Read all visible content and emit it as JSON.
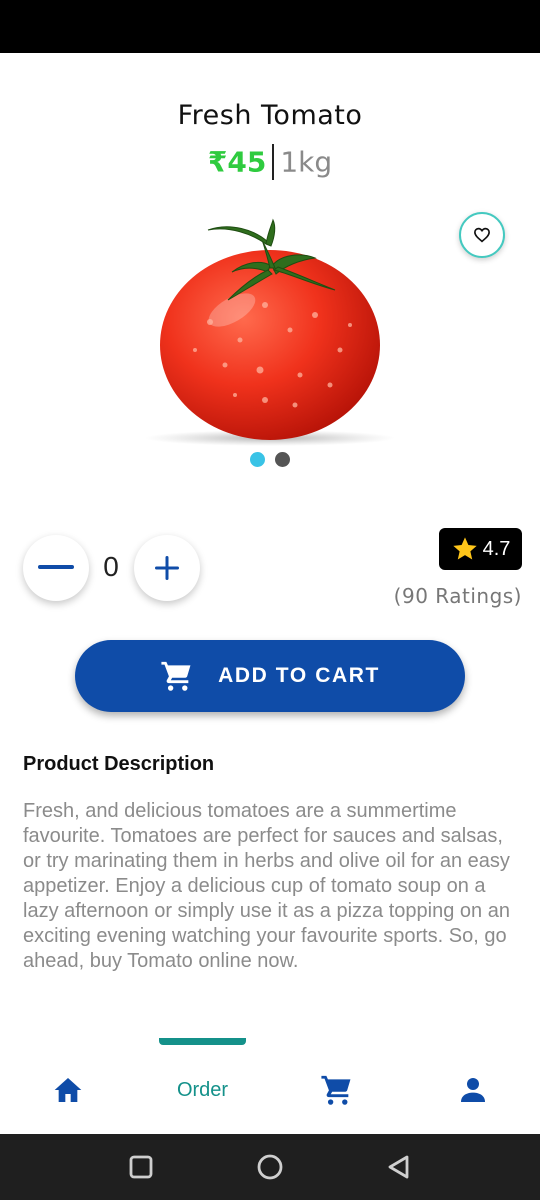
{
  "product": {
    "name": "Fresh Tomato",
    "price": "₹45",
    "unit": "1kg",
    "image_icon": "tomato-image"
  },
  "carousel": {
    "count": 2,
    "active_index": 0,
    "active_color": "#39c3e6",
    "inactive_color": "#555555"
  },
  "quantity": {
    "value": "0",
    "minus_icon": "minus-icon",
    "plus_icon": "plus-icon"
  },
  "rating": {
    "value": "4.7",
    "count_label": "(90 Ratings)",
    "icon": "star-icon"
  },
  "cart_button": {
    "label": "ADD TO CART",
    "icon": "cart-icon",
    "color": "#0f4ca8"
  },
  "description": {
    "title": "Product Description",
    "text": "Fresh, and delicious tomatoes are a summertime favourite. Tomatoes are perfect for sauces and salsas, or try marinating them in herbs and olive oil for an easy appetizer. Enjoy a delicious cup of tomato soup on a lazy afternoon or simply use it as a pizza topping on an exciting evening watching your favourite sports. So, go ahead, buy Tomato online now."
  },
  "bottom_nav": {
    "items": [
      {
        "name": "home",
        "icon": "home-icon"
      },
      {
        "name": "order",
        "label": "Order",
        "active": true
      },
      {
        "name": "cart",
        "icon": "cart-icon"
      },
      {
        "name": "profile",
        "icon": "person-icon"
      }
    ],
    "active_color": "#14918a",
    "icon_color": "#0f4ca8"
  },
  "colors": {
    "price": "#2fcb3f",
    "accent": "#14918a",
    "primary": "#0f4ca8"
  }
}
